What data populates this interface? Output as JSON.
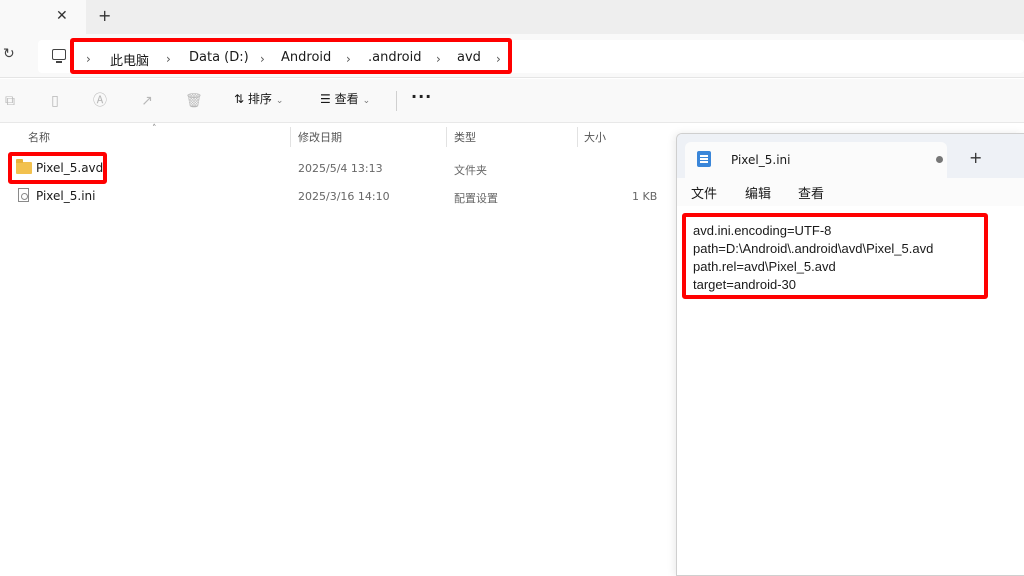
{
  "tabstrip": {
    "close_glyph": "✕",
    "new_tab_glyph": "+"
  },
  "address": {
    "refresh_glyph": "↻",
    "separator": "›",
    "crumbs": [
      "此电脑",
      "Data (D:)",
      "Android",
      ".android",
      "avd"
    ]
  },
  "toolbar": {
    "sort_label": "排序",
    "view_label": "查看",
    "more_glyph": "···"
  },
  "file_list": {
    "columns": [
      "名称",
      "修改日期",
      "类型",
      "大小"
    ],
    "rows": [
      {
        "name": "Pixel_5.avd",
        "modified": "2025/5/4 13:13",
        "type": "文件夹",
        "size": "",
        "icon": "folder-icon"
      },
      {
        "name": "Pixel_5.ini",
        "modified": "2025/3/16 14:10",
        "type": "配置设置",
        "size": "1 KB",
        "icon": "ini-file-icon"
      }
    ]
  },
  "notepad": {
    "tab_title": "Pixel_5.ini",
    "new_tab_glyph": "+",
    "menu": [
      "文件",
      "编辑",
      "查看"
    ],
    "lines": [
      "avd.ini.encoding=UTF-8",
      "path=D:\\Android\\.android\\avd\\Pixel_5.avd",
      "path.rel=avd\\Pixel_5.avd",
      "target=android-30"
    ]
  },
  "colors": {
    "highlight": "#ff0000",
    "folder": "#f2c14e",
    "notepad_icon": "#3a86d9"
  }
}
